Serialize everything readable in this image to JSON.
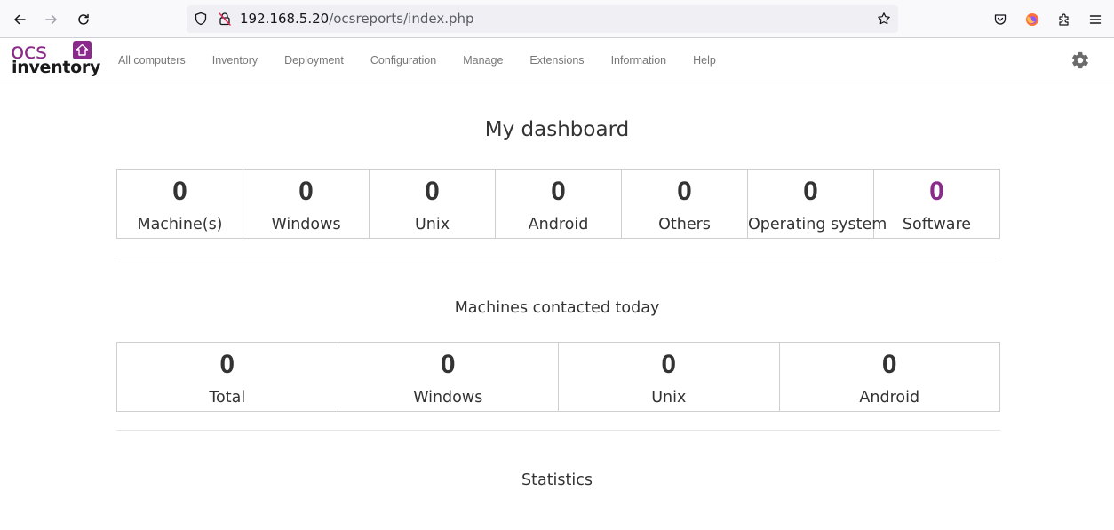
{
  "browser": {
    "url_host": "192.168.5.20",
    "url_path": "/ocsreports/index.php"
  },
  "app": {
    "logo_top": "ocs",
    "logo_bottom": "inventory",
    "menu": [
      {
        "label": "All computers"
      },
      {
        "label": "Inventory"
      },
      {
        "label": "Deployment"
      },
      {
        "label": "Configuration"
      },
      {
        "label": "Manage"
      },
      {
        "label": "Extensions"
      },
      {
        "label": "Information"
      },
      {
        "label": "Help"
      }
    ]
  },
  "dashboard": {
    "title": "My dashboard",
    "summary": [
      {
        "value": "0",
        "label": "Machine(s)"
      },
      {
        "value": "0",
        "label": "Windows"
      },
      {
        "value": "0",
        "label": "Unix"
      },
      {
        "value": "0",
        "label": "Android"
      },
      {
        "value": "0",
        "label": "Others"
      },
      {
        "value": "0",
        "label": "Operating system"
      },
      {
        "value": "0",
        "label": "Software"
      }
    ],
    "contacted_title": "Machines contacted today",
    "contacted": [
      {
        "value": "0",
        "label": "Total"
      },
      {
        "value": "0",
        "label": "Windows"
      },
      {
        "value": "0",
        "label": "Unix"
      },
      {
        "value": "0",
        "label": "Android"
      }
    ],
    "statistics_title": "Statistics"
  },
  "colors": {
    "brand": "#8a2a8a",
    "text": "#333333",
    "menu_text": "#777777"
  }
}
